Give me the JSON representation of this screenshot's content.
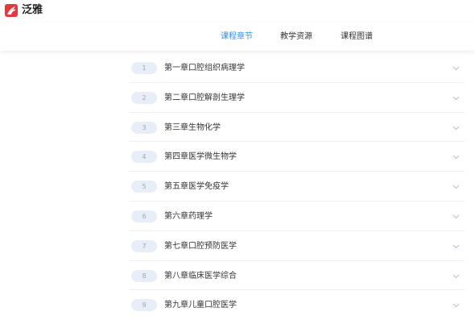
{
  "app": {
    "name": "泛雅",
    "logo_icon": "fanya-logo-icon",
    "brand_color": "#e4383d"
  },
  "tabs": [
    {
      "label": "课程章节",
      "active": true
    },
    {
      "label": "教学资源",
      "active": false
    },
    {
      "label": "课程图谱",
      "active": false
    }
  ],
  "accent_color": "#3a8ee6",
  "chapters": [
    {
      "number": "1",
      "title": "第一章口腔组织病理学"
    },
    {
      "number": "2",
      "title": "第二章口腔解剖生理学"
    },
    {
      "number": "3",
      "title": "第三章生物化学"
    },
    {
      "number": "4",
      "title": "第四章医学微生物学"
    },
    {
      "number": "5",
      "title": "第五章医学免疫学"
    },
    {
      "number": "6",
      "title": "第六章药理学"
    },
    {
      "number": "7",
      "title": "第七章口腔预防医学"
    },
    {
      "number": "8",
      "title": "第八章临床医学综合"
    },
    {
      "number": "9",
      "title": "第九章儿童口腔医学"
    }
  ],
  "expand_icon": "chevron-down-icon"
}
